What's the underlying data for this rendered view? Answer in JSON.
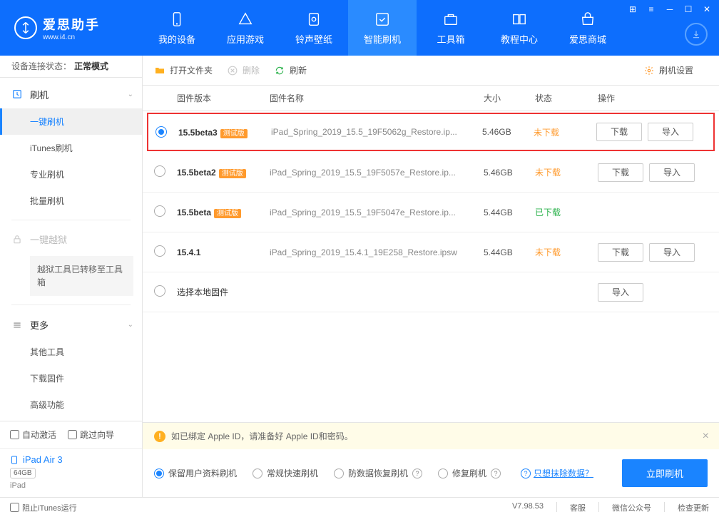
{
  "app": {
    "title": "爱思助手",
    "url": "www.i4.cn"
  },
  "nav": [
    {
      "label": "我的设备"
    },
    {
      "label": "应用游戏"
    },
    {
      "label": "铃声壁纸"
    },
    {
      "label": "智能刷机",
      "active": true
    },
    {
      "label": "工具箱"
    },
    {
      "label": "教程中心"
    },
    {
      "label": "爱思商城"
    }
  ],
  "sidebar": {
    "conn_label": "设备连接状态：",
    "conn_value": "正常模式",
    "flash_head": "刷机",
    "items_flash": [
      "一键刷机",
      "iTunes刷机",
      "专业刷机",
      "批量刷机"
    ],
    "jailbreak_head": "一键越狱",
    "jailbreak_notice": "越狱工具已转移至工具箱",
    "more_head": "更多",
    "items_more": [
      "其他工具",
      "下载固件",
      "高级功能"
    ],
    "auto_activate": "自动激活",
    "skip_guide": "跳过向导",
    "device_name": "iPad Air 3",
    "device_cap": "64GB",
    "device_type": "iPad"
  },
  "toolbar": {
    "open": "打开文件夹",
    "delete": "删除",
    "refresh": "刷新",
    "settings": "刷机设置"
  },
  "table": {
    "h_ver": "固件版本",
    "h_name": "固件名称",
    "h_size": "大小",
    "h_status": "状态",
    "h_ops": "操作",
    "beta_tag": "测试版",
    "rows": [
      {
        "ver": "15.5beta3",
        "beta": true,
        "name": "iPad_Spring_2019_15.5_19F5062g_Restore.ip...",
        "size": "5.46GB",
        "status": "未下载",
        "st_class": "st-notdl",
        "sel": true,
        "hl": true,
        "dl": true
      },
      {
        "ver": "15.5beta2",
        "beta": true,
        "name": "iPad_Spring_2019_15.5_19F5057e_Restore.ip...",
        "size": "5.46GB",
        "status": "未下载",
        "st_class": "st-notdl",
        "dl": true
      },
      {
        "ver": "15.5beta",
        "beta": true,
        "name": "iPad_Spring_2019_15.5_19F5047e_Restore.ip...",
        "size": "5.44GB",
        "status": "已下载",
        "st_class": "st-dl"
      },
      {
        "ver": "15.4.1",
        "name": "iPad_Spring_2019_15.4.1_19E258_Restore.ipsw",
        "size": "5.44GB",
        "status": "未下载",
        "st_class": "st-notdl",
        "dl": true
      },
      {
        "local": true,
        "name": "选择本地固件"
      }
    ],
    "btn_dl": "下载",
    "btn_import": "导入"
  },
  "notice": "如已绑定 Apple ID，请准备好 Apple ID和密码。",
  "flash": {
    "opt1": "保留用户资料刷机",
    "opt2": "常规快速刷机",
    "opt3": "防数据恢复刷机",
    "opt4": "修复刷机",
    "link": "只想抹除数据？",
    "btn": "立即刷机"
  },
  "status": {
    "block_itunes": "阻止iTunes运行",
    "version": "V7.98.53",
    "s1": "客服",
    "s2": "微信公众号",
    "s3": "检查更新"
  }
}
